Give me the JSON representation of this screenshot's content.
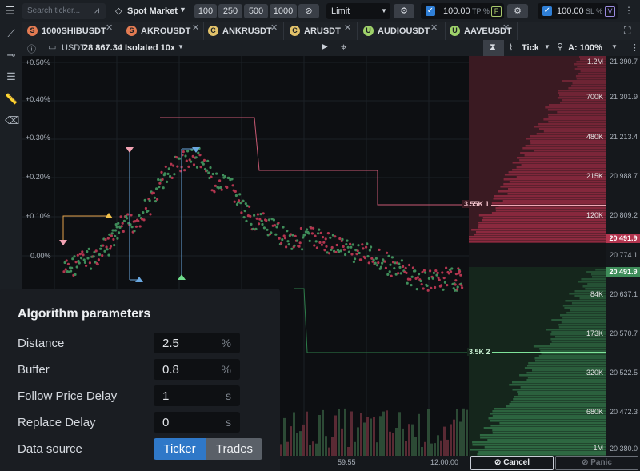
{
  "topbar": {
    "search_placeholder": "Search ticker...",
    "market_label": "Spot Market",
    "qty_buttons": [
      "100",
      "250",
      "500",
      "1000"
    ],
    "order_type": "Limit",
    "tp_value": "100.00",
    "tp_label": "TP %",
    "tp_tag": "F",
    "sl_value": "100.00",
    "sl_label": "SL %",
    "sl_tag": "V"
  },
  "tabs": [
    {
      "icon": "S",
      "label": "1000SHIBUSDT"
    },
    {
      "icon": "S",
      "label": "AKROUSDT"
    },
    {
      "icon": "C",
      "label": "ANKRUSDT"
    },
    {
      "icon": "C",
      "label": "ARUSDT"
    },
    {
      "icon": "U",
      "label": "AUDIOUSDT"
    },
    {
      "icon": "U",
      "label": "AAVEUSDT"
    }
  ],
  "subbar": {
    "balance_currency": "USDT",
    "balance_value": "28 867.34",
    "margin_mode": "Isolated 10x",
    "aggregation": "Tick",
    "zoom": "A: 100%"
  },
  "chart": {
    "percent_ticks": [
      "+0.50%",
      "+0.40%",
      "+0.30%",
      "+0.20%",
      "+0.10%",
      "0.00%"
    ],
    "price_ticks": [
      "21 390.7",
      "21 301.9",
      "21 213.4",
      "20 988.7",
      "20 809.2",
      "20 491.9",
      "20 774.1",
      "20 491.9",
      "20 637.1",
      "20 570.7",
      "20 522.5",
      "20 472.3",
      "20 380.0"
    ],
    "ask_sizes": [
      "1.2M",
      "700K",
      "480K",
      "215K",
      "120K"
    ],
    "bid_sizes": [
      "84K",
      "173K",
      "320K",
      "680K",
      "1M"
    ],
    "ask_level_label": "3.55K 1",
    "bid_level_label": "3.5K 2",
    "time_ticks": [
      "59:55",
      "12:00:00"
    ],
    "colors": {
      "ask": "#b3354f",
      "bid": "#3f8d5a",
      "ask_line": "#e88ea0",
      "bid_line": "#6fdc8c"
    }
  },
  "bottom": {
    "cancel_label": "Cancel",
    "panic_label": "Panic"
  },
  "params": {
    "title": "Algorithm parameters",
    "rows": [
      {
        "label": "Distance",
        "value": "2.5",
        "unit": "%"
      },
      {
        "label": "Buffer",
        "value": "0.8",
        "unit": "%"
      },
      {
        "label": "Follow Price Delay",
        "value": "1",
        "unit": "s"
      },
      {
        "label": "Replace Delay",
        "value": "0",
        "unit": "s"
      }
    ],
    "source_label": "Data source",
    "source_options": [
      "Ticker",
      "Trades"
    ],
    "source_selected": "Ticker"
  }
}
